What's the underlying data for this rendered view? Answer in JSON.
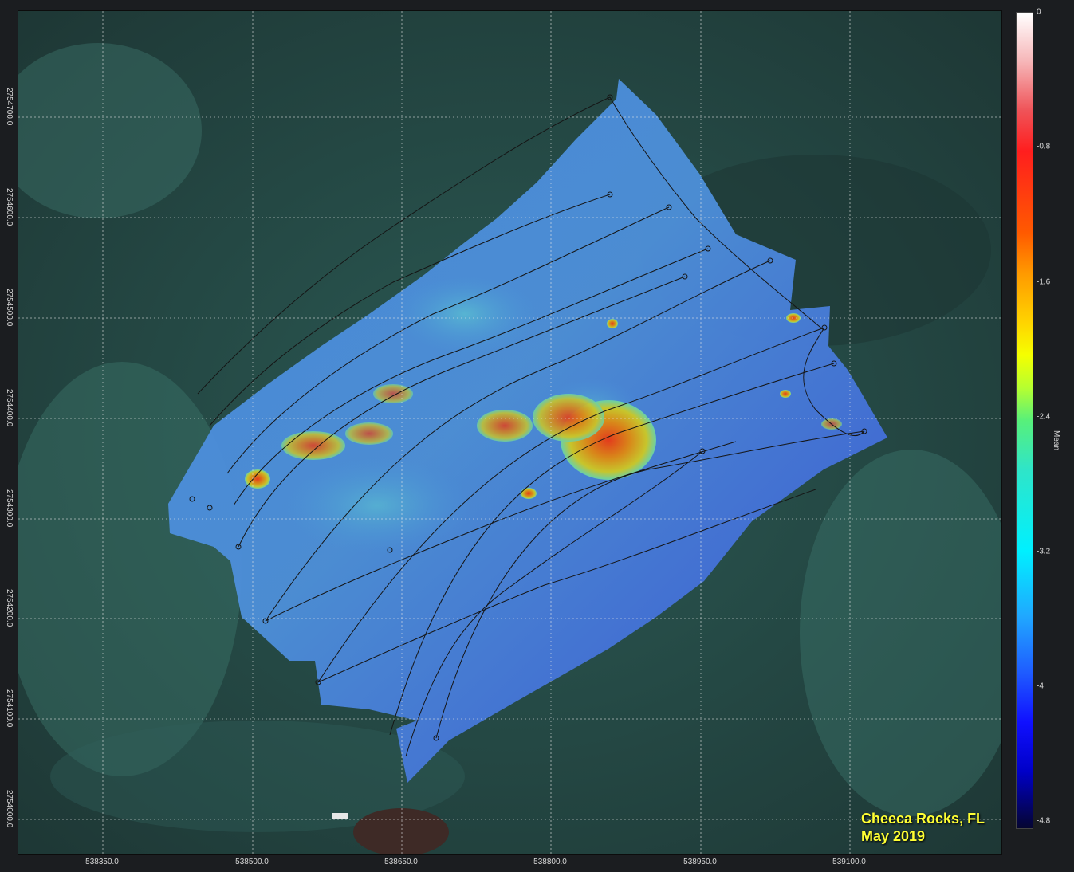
{
  "map": {
    "caption_line1": "Cheeca Rocks, FL",
    "caption_line2": "May 2019",
    "x_ticks": [
      "538350.0",
      "538500.0",
      "538650.0",
      "538800.0",
      "538950.0",
      "539100.0"
    ],
    "y_ticks": [
      "2754700.0",
      "2754600.0",
      "2754500.0",
      "2754400.0",
      "2754300.0",
      "2754200.0",
      "2754100.0",
      "2754000.0"
    ],
    "colorbar": {
      "title": "Mean",
      "ticks": [
        "0",
        "-0.8",
        "-1.6",
        "-2.4",
        "-3.2",
        "-4",
        "-4.8"
      ],
      "colors": [
        "#ffffff",
        "#ff1e1e",
        "#ff9a00",
        "#f5ff00",
        "#58f07a",
        "#00f0ff",
        "#1f5bff",
        "#0000c8",
        "#050530"
      ]
    },
    "caption_color": "#ffff33"
  }
}
